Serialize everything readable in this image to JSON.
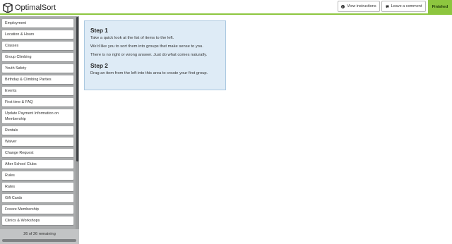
{
  "brand": {
    "name": "OptimalSort"
  },
  "header": {
    "view_instructions": "View instructions",
    "leave_comment": "Leave a comment",
    "finished": "Finished",
    "accent_color": "#8dc63f"
  },
  "sidebar": {
    "items": [
      {
        "label": "Employment"
      },
      {
        "label": "Location & Hours"
      },
      {
        "label": "Classes"
      },
      {
        "label": "Group Climbing"
      },
      {
        "label": "Youth Safety"
      },
      {
        "label": "Birthday & Climbing Parties"
      },
      {
        "label": "Events"
      },
      {
        "label": "First time & FAQ"
      },
      {
        "label": "Update Payment Information on Membership"
      },
      {
        "label": "Rentals"
      },
      {
        "label": "Waiver"
      },
      {
        "label": "Change Request"
      },
      {
        "label": "After School Clubs"
      },
      {
        "label": "Rules"
      },
      {
        "label": "Rates"
      },
      {
        "label": "Gift Cards"
      },
      {
        "label": "Freeze Membership"
      },
      {
        "label": "Clinics & Workshops"
      }
    ],
    "remaining": "26 of 26 remaining"
  },
  "instructions": {
    "step1_title": "Step 1",
    "step1_line1": "Take a quick look at the list of items to the left.",
    "step1_line2": "We'd like you to sort them into groups that make sense to you.",
    "step1_line3": "There is no right or wrong answer. Just do what comes naturally.",
    "step2_title": "Step 2",
    "step2_line1": "Drag an item from the left into this area to create your first group."
  }
}
